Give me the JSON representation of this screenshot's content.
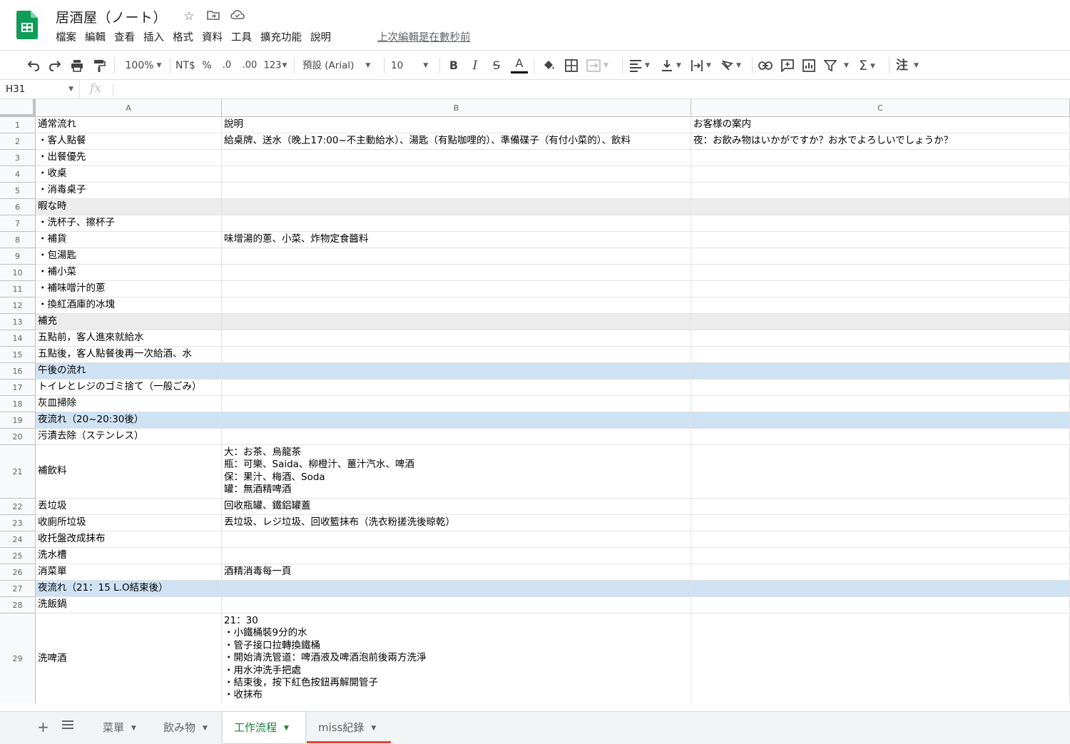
{
  "document": {
    "title": "居酒屋（ノート）",
    "last_edit": "上次編輯是在數秒前"
  },
  "menu": [
    "檔案",
    "編輯",
    "查看",
    "插入",
    "格式",
    "資料",
    "工具",
    "擴充功能",
    "說明"
  ],
  "toolbar": {
    "zoom": "100%",
    "currency": "NT$",
    "percent": "%",
    "decimal_decrease": ".0",
    "decimal_increase": ".00",
    "number_format": "123",
    "font": "預設 (Arial)",
    "font_size": "10",
    "bold": "B",
    "italic": "I",
    "strike": "S",
    "text_color": "A",
    "input_tools": "注"
  },
  "formula_bar": {
    "cell_ref": "H31",
    "fx": "fx",
    "value": ""
  },
  "columns": [
    "A",
    "B",
    "C"
  ],
  "rows": [
    {
      "n": "1",
      "a": "通常流れ",
      "b": "說明",
      "c": "お客様の案内"
    },
    {
      "n": "2",
      "a": "・客人點餐",
      "b": "給桌牌、送水（晚上17:00~不主動給水）、湯匙（有點咖哩的）、準備碟子（有付小菜的）、飲料",
      "c": "夜：お飲み物はいかがですか？お水でよろしいでしょうか？"
    },
    {
      "n": "3",
      "a": "・出餐優先",
      "b": "",
      "c": ""
    },
    {
      "n": "4",
      "a": "・收桌",
      "b": "",
      "c": ""
    },
    {
      "n": "5",
      "a": "・消毒桌子",
      "b": "",
      "c": ""
    },
    {
      "n": "6",
      "a": "暇な時",
      "b": "",
      "c": "",
      "hl": "gray"
    },
    {
      "n": "7",
      "a": "・洗杯子、擦杯子",
      "b": "",
      "c": ""
    },
    {
      "n": "8",
      "a": "・補貨",
      "b": "味增湯的蔥、小菜、炸物定食醬料",
      "c": ""
    },
    {
      "n": "9",
      "a": "・包湯匙",
      "b": "",
      "c": ""
    },
    {
      "n": "10",
      "a": "・補小菜",
      "b": "",
      "c": ""
    },
    {
      "n": "11",
      "a": "・補味噌汁的蔥",
      "b": "",
      "c": ""
    },
    {
      "n": "12",
      "a": "・換紅酒庫的冰塊",
      "b": "",
      "c": ""
    },
    {
      "n": "13",
      "a": "補充",
      "b": "",
      "c": "",
      "hl": "gray"
    },
    {
      "n": "14",
      "a": "五點前，客人進來就給水",
      "b": "",
      "c": ""
    },
    {
      "n": "15",
      "a": "五點後，客人點餐後再一次給酒、水",
      "b": "",
      "c": ""
    },
    {
      "n": "16",
      "a": "午後の流れ",
      "b": "",
      "c": "",
      "hl": "blue"
    },
    {
      "n": "17",
      "a": "トイレとレジのゴミ捨て（一般ごみ）",
      "b": "",
      "c": ""
    },
    {
      "n": "18",
      "a": "灰皿掃除",
      "b": "",
      "c": ""
    },
    {
      "n": "19",
      "a": "夜流れ（20~20:30後）",
      "b": "",
      "c": "",
      "hl": "blue"
    },
    {
      "n": "20",
      "a": "污漬去除（ステンレス）",
      "b": "",
      "c": ""
    },
    {
      "n": "21",
      "a": "補飲料",
      "b": "大：お茶、烏龍茶\n瓶：可樂、Saida、柳橙汁、薑汁汽水、啤酒\n保：果汁、梅酒、Soda\n罐：無酒精啤酒",
      "c": ""
    },
    {
      "n": "22",
      "a": "丟垃圾",
      "b": "回收瓶罐、鐵鋁罐蓋",
      "c": ""
    },
    {
      "n": "23",
      "a": "收廁所垃圾",
      "b": "丟垃圾、レジ垃圾、回收籃抹布（洗衣粉搓洗後晾乾）",
      "c": ""
    },
    {
      "n": "24",
      "a": "收托盤改成抹布",
      "b": "",
      "c": ""
    },
    {
      "n": "25",
      "a": "洗水槽",
      "b": "",
      "c": ""
    },
    {
      "n": "26",
      "a": "消菜單",
      "b": "酒精消毒每一頁",
      "c": ""
    },
    {
      "n": "27",
      "a": "夜流れ（21：15 L.O結束後）",
      "b": "",
      "c": "",
      "hl": "blue"
    },
    {
      "n": "28",
      "a": "洗飯鍋",
      "b": "",
      "c": ""
    },
    {
      "n": "29",
      "a": "洗啤酒",
      "b": "21：30\n・小鐵桶裝9分的水\n・管子接口拉轉換鐵桶\n・開始清洗管道：啤酒液及啤酒泡前後兩方洗淨\n・用水沖洗手把處\n・結束後，按下紅色按鈕再解開管子\n・收抹布",
      "c": ""
    }
  ],
  "sheets": [
    {
      "label": "菜單",
      "active": false
    },
    {
      "label": "飲み物",
      "active": false
    },
    {
      "label": "工作流程",
      "active": true
    },
    {
      "label": "miss紀錄",
      "active": false,
      "underline": "#ea4335"
    }
  ],
  "colors": {
    "highlight_gray": "#ececec",
    "highlight_blue": "#cfe2f3",
    "active_tab_text": "#188038",
    "logo_green": "#0f9d58"
  }
}
